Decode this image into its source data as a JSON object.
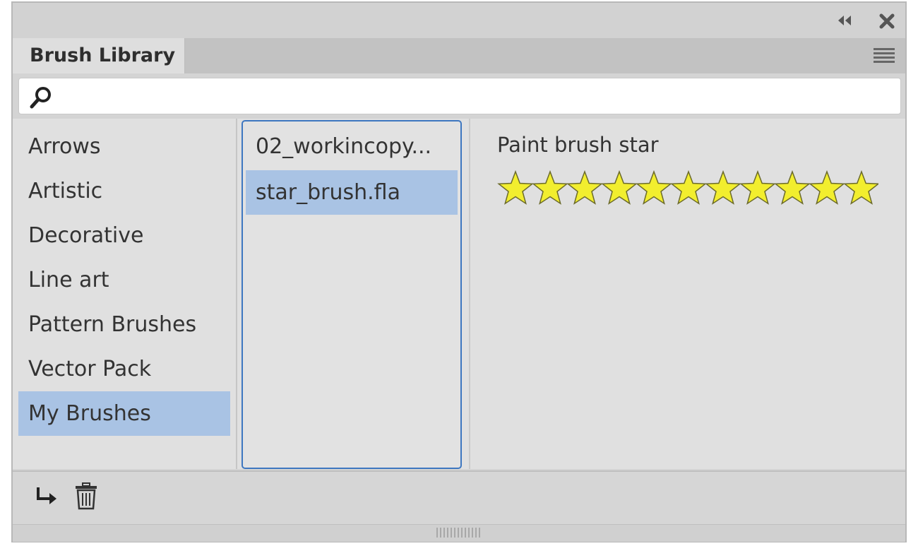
{
  "panel": {
    "tab_title": "Brush Library",
    "controls": {
      "collapse": "collapse-icon",
      "close": "close-icon",
      "menu": "menu-icon"
    }
  },
  "search": {
    "value": "",
    "placeholder": "",
    "icon": "search-icon"
  },
  "categories": {
    "items": [
      {
        "label": "Arrows"
      },
      {
        "label": "Artistic"
      },
      {
        "label": "Decorative"
      },
      {
        "label": "Line art"
      },
      {
        "label": "Pattern Brushes"
      },
      {
        "label": "Vector Pack"
      },
      {
        "label": "My Brushes"
      }
    ],
    "selected_index": 6
  },
  "files": {
    "items": [
      {
        "label": "02_workincopy..."
      },
      {
        "label": "star_brush.fla"
      }
    ],
    "selected_index": 1
  },
  "preview": {
    "brush_name": "Paint brush star",
    "star_count": 11,
    "star_fill": "#f2ee2e",
    "star_stroke": "#6b6a2a"
  },
  "bottom": {
    "import_icon": "import-arrow-icon",
    "delete_icon": "trash-icon"
  },
  "colors": {
    "selection": "#a9c3e4",
    "focus_border": "#3e77c0",
    "panel_bg": "#e0e0e0"
  }
}
